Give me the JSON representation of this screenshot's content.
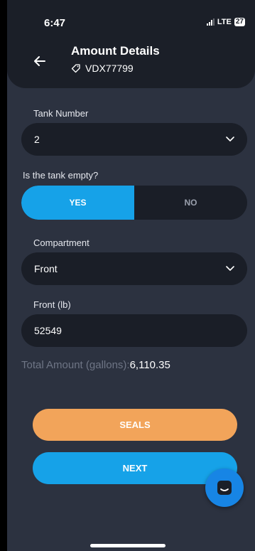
{
  "status_bar": {
    "time": "6:47",
    "network": "LTE",
    "battery": "27"
  },
  "header": {
    "title": "Amount Details",
    "subtitle": "VDX77799"
  },
  "form": {
    "tank_number": {
      "label": "Tank Number",
      "value": "2"
    },
    "tank_empty": {
      "label": "Is the tank empty?",
      "yes": "YES",
      "no": "NO",
      "selected": "YES"
    },
    "compartment": {
      "label": "Compartment",
      "value": "Front"
    },
    "front_lb": {
      "label": "Front (lb)",
      "value": "52549"
    },
    "total": {
      "label": "Total Amount (gallons):",
      "value": "6,110.35"
    }
  },
  "buttons": {
    "seals": "SEALS",
    "next": "NEXT"
  },
  "colors": {
    "primary": "#16a2e8",
    "secondary": "#f2a45a",
    "background": "#2c3240",
    "field": "#1a1e27"
  },
  "icons": [
    "back-arrow-icon",
    "tag-icon",
    "chevron-down-icon",
    "chat-icon"
  ]
}
